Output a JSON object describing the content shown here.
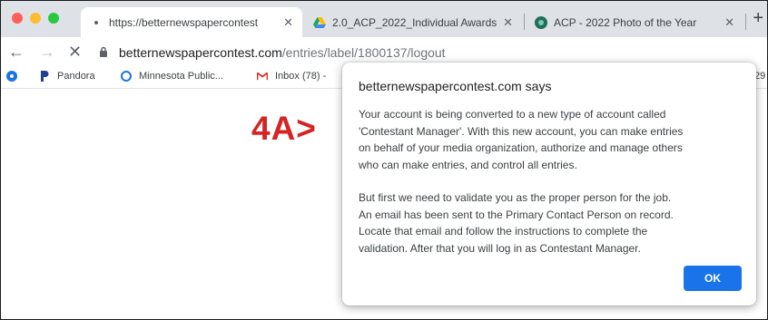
{
  "window_controls": {
    "close_color": "#ff5f57",
    "minimize_color": "#febc2e",
    "maximize_color": "#28c840"
  },
  "tabs": [
    {
      "title": "https://betternewspapercontest",
      "icon": "loading-dot-icon",
      "active": true
    },
    {
      "title": "2.0_ACP_2022_Individual Awards",
      "icon": "google-drive-icon",
      "active": false
    },
    {
      "title": "ACP - 2022 Photo of the Year",
      "icon": "acp-logo-icon",
      "active": false
    }
  ],
  "toolbar": {
    "url_host": "betternewspapercontest.com",
    "url_path": "/entries/label/1800137/logout"
  },
  "bookmarks": [
    {
      "label": "Pandora",
      "icon": "pandora-icon"
    },
    {
      "label": "Minnesota Public...",
      "icon": "mpr-icon"
    },
    {
      "label": "Inbox (78) -",
      "icon": "gmail-icon"
    }
  ],
  "bookmarks_overflow": "29",
  "annotation": "4A>",
  "dialog": {
    "title": "betternewspapercontest.com says",
    "paragraph1_lines": [
      "Your account is being converted to a new type of account called",
      "'Contestant Manager'. With this new account, you can make entries",
      "on behalf of your media organization, authorize and manage others",
      "who can make entries, and control all entries."
    ],
    "paragraph2_lines": [
      "But first we need to validate you as the proper person for the job.",
      "An email has been sent to the Primary Contact Person on record.",
      "Locate that email and follow the instructions to complete the",
      "validation. After that you will log in as Contestant Manager."
    ],
    "ok_label": "OK"
  },
  "colors": {
    "accent": "#1a73e8",
    "annotation_red": "#d42424"
  }
}
